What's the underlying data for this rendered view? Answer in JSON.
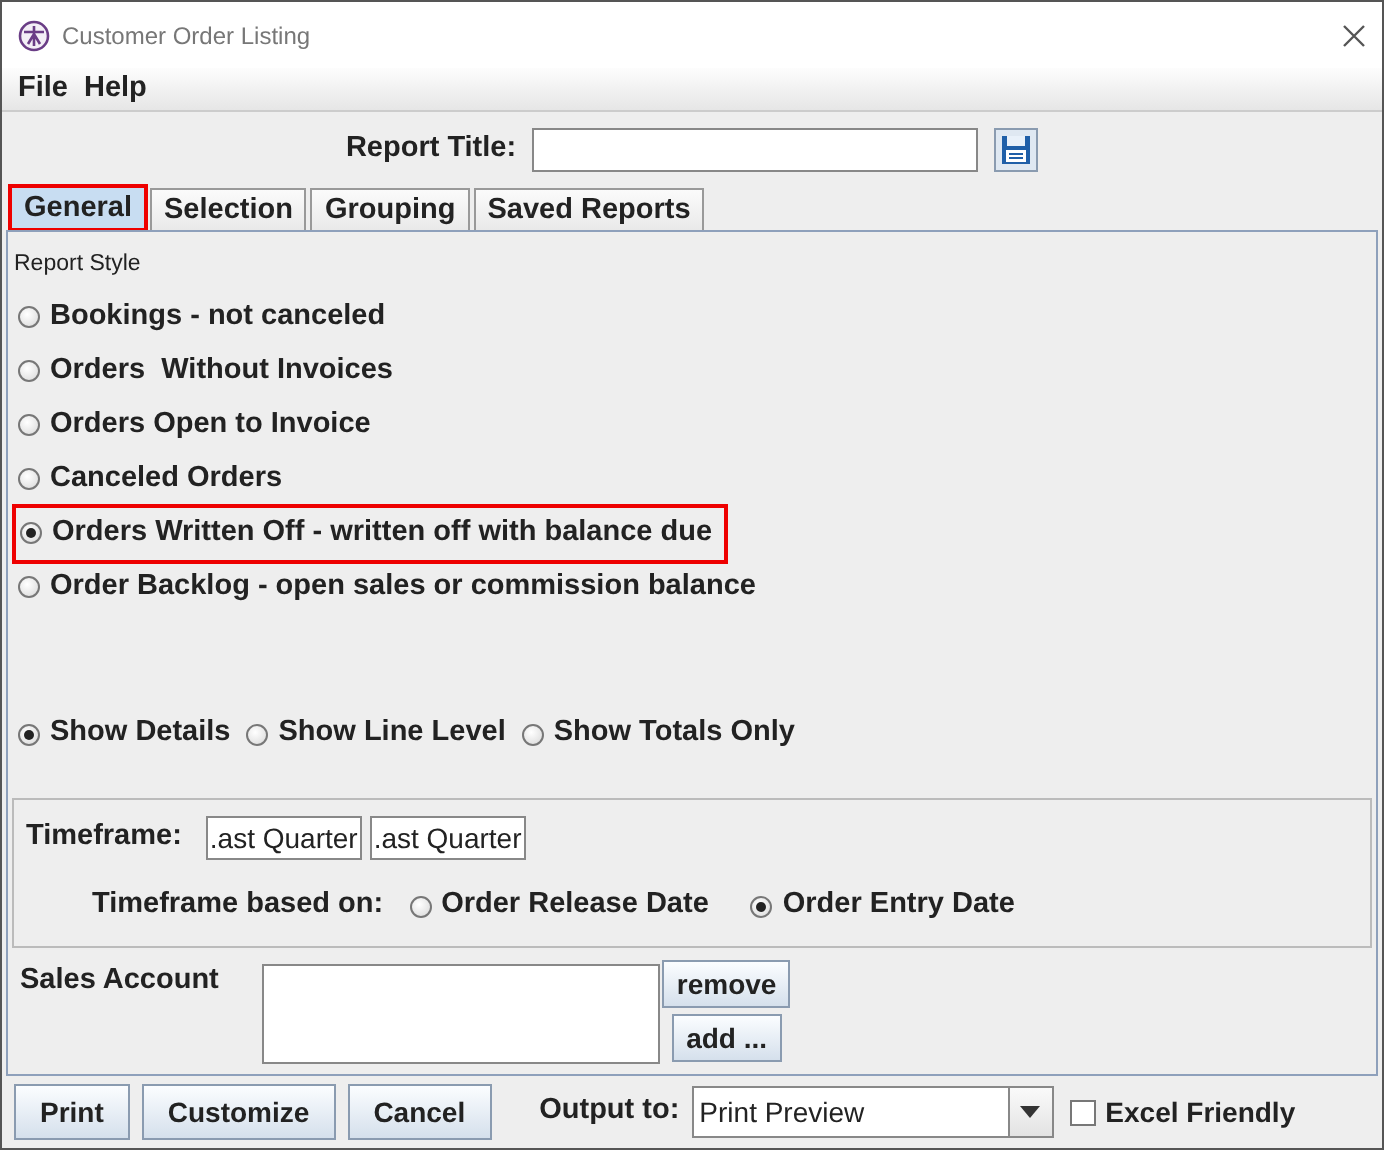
{
  "window": {
    "title": "Customer Order Listing"
  },
  "menu": [
    "File",
    "Help"
  ],
  "report_title": {
    "label": "Report Title:"
  },
  "tabs": [
    {
      "label": "General",
      "selected": true,
      "highlighted": true
    },
    {
      "label": "Selection",
      "selected": false,
      "highlighted": false
    },
    {
      "label": "Grouping",
      "selected": false,
      "highlighted": false
    },
    {
      "label": "Saved Reports",
      "selected": false,
      "highlighted": false
    }
  ],
  "report_style": {
    "label": "Report Style",
    "options": [
      {
        "label": "Bookings - not canceled",
        "selected": false,
        "highlighted": false
      },
      {
        "label": "Orders  Without Invoices",
        "selected": false,
        "highlighted": false
      },
      {
        "label": "Orders Open to Invoice",
        "selected": false,
        "highlighted": false
      },
      {
        "label": "Canceled Orders",
        "selected": false,
        "highlighted": false
      },
      {
        "label": "Orders Written Off - written off with balance due",
        "selected": true,
        "highlighted": true
      },
      {
        "label": "Order Backlog - open sales or commission balance",
        "selected": false,
        "highlighted": false
      }
    ]
  },
  "detail_level": [
    {
      "label": "Show Details",
      "selected": true
    },
    {
      "label": "Show Line Level",
      "selected": false
    },
    {
      "label": "Show Totals Only",
      "selected": false
    }
  ],
  "timeframe": {
    "label": "Timeframe:",
    "from": ".ast Quarter",
    "to": ".ast Quarter",
    "based_on_label": "Timeframe based on:",
    "based_on": [
      {
        "label": "Order Release Date",
        "selected": false
      },
      {
        "label": "Order Entry Date",
        "selected": true
      }
    ]
  },
  "sales_account": {
    "label": "Sales Account",
    "buttons": [
      "remove",
      "add ..."
    ]
  },
  "footer": {
    "buttons": [
      "Print",
      "Customize",
      "Cancel"
    ],
    "output_label": "Output to:",
    "output": "Print Preview",
    "excel": {
      "label": "Excel Friendly",
      "checked": false
    }
  }
}
